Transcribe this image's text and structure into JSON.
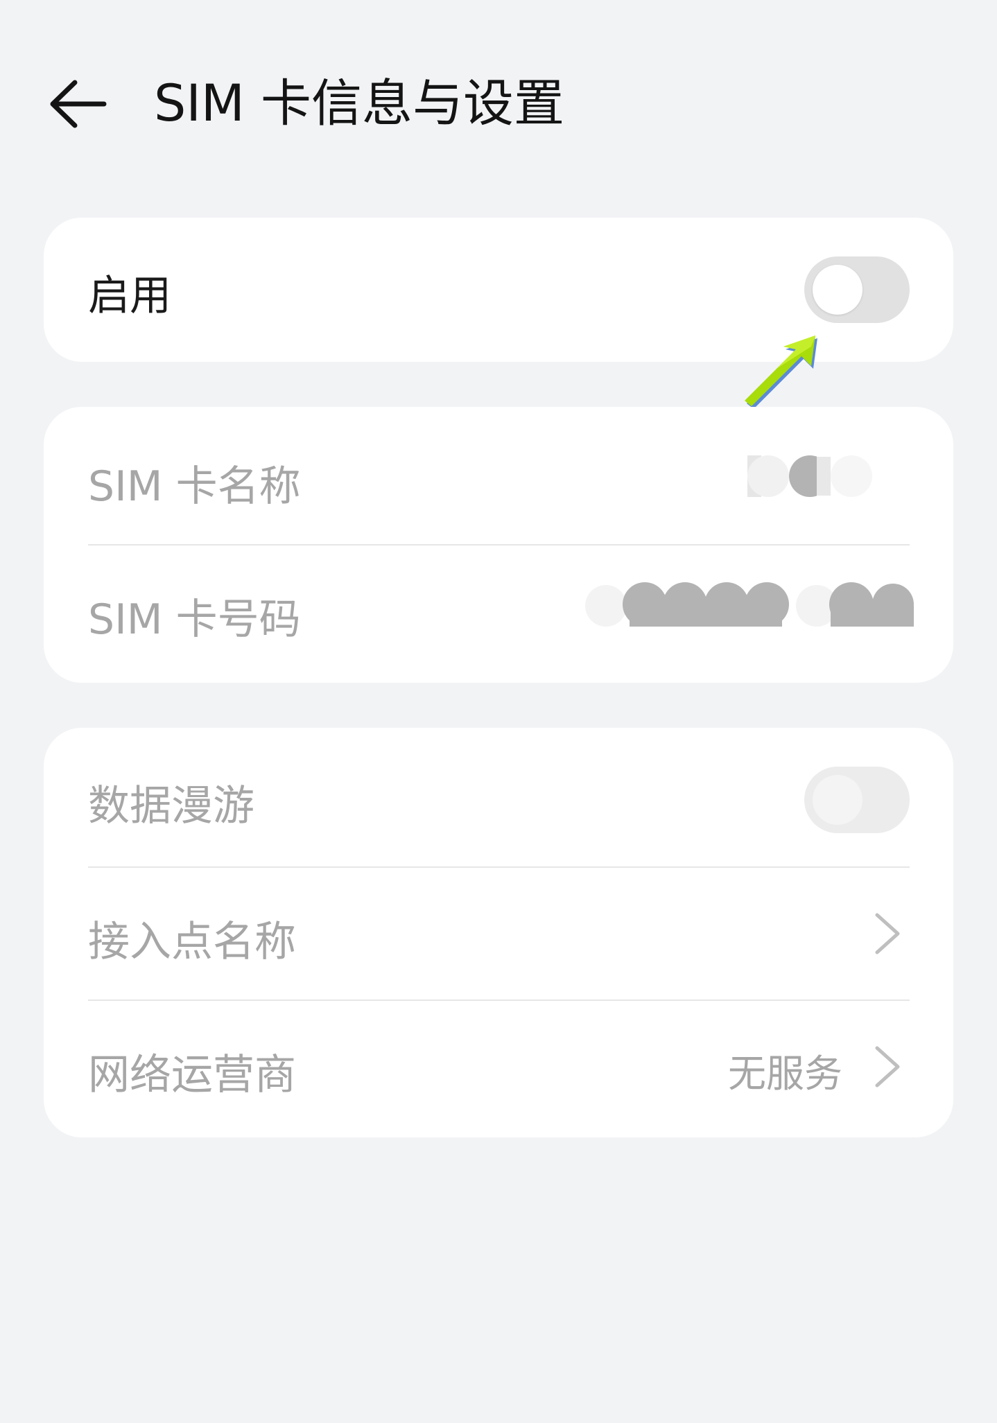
{
  "header": {
    "back_icon": "back-arrow-icon",
    "title": "SIM 卡信息与设置"
  },
  "sim_enable": {
    "label": "启用",
    "toggle_on": false
  },
  "sim_info": {
    "name_label": "SIM 卡名称",
    "number_label": "SIM 卡号码"
  },
  "network": {
    "roaming_label": "数据漫游",
    "roaming_on": false,
    "roaming_enabled": false,
    "apn_label": "接入点名称",
    "carrier_label": "网络运营商",
    "carrier_value": "无服务",
    "chevron_icon": "chevron-right-icon"
  },
  "colors": {
    "background": "#f2f3f5",
    "card": "#ffffff",
    "primary_text": "#141414",
    "disabled_text": "#a6a6a6",
    "toggle_off": "#e1e1e1",
    "annotation_arrow": "#a8dc0a"
  }
}
